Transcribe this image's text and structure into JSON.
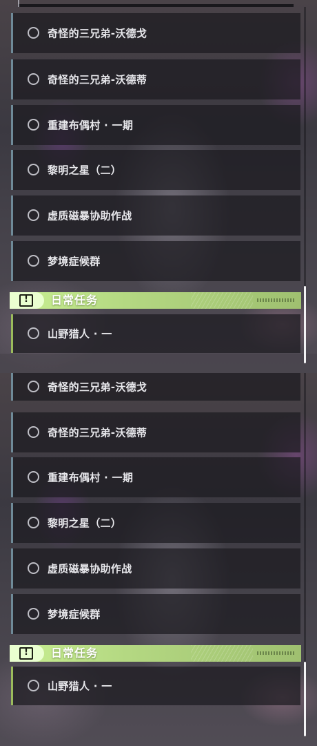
{
  "panels": [
    {
      "quests": [
        {
          "label": "奇怪的三兄弟-沃德戈"
        },
        {
          "label": "奇怪的三兄弟-沃德蒂"
        },
        {
          "label": "重建布偶村 · 一期"
        },
        {
          "label": "黎明之星（二）"
        },
        {
          "label": "虚质磁暴协助作战"
        },
        {
          "label": "梦境症候群"
        }
      ],
      "daily_section": {
        "title": "日常任务",
        "icon": "alert-icon"
      },
      "daily_quests": [
        {
          "label": "山野猎人 · 一"
        }
      ]
    },
    {
      "quests": [
        {
          "label": "奇怪的三兄弟-沃德戈"
        },
        {
          "label": "奇怪的三兄弟-沃德蒂"
        },
        {
          "label": "重建布偶村 · 一期"
        },
        {
          "label": "黎明之星（二）"
        },
        {
          "label": "虚质磁暴协助作战"
        },
        {
          "label": "梦境症候群"
        }
      ],
      "daily_section": {
        "title": "日常任务",
        "icon": "alert-icon"
      },
      "daily_quests": [
        {
          "label": "山野猎人 · 一"
        }
      ]
    }
  ],
  "colors": {
    "quest_accent": "#6f8a98",
    "daily_accent": "#9bbb5c",
    "header_green": "#c9ef92"
  }
}
